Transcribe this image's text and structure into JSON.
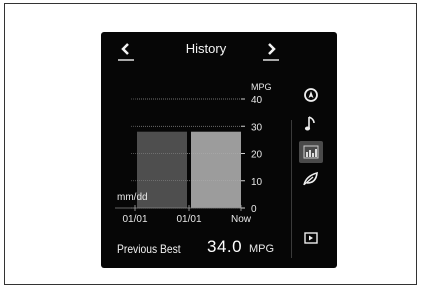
{
  "screen": {
    "title": "History",
    "prev_label": "<",
    "next_label": ">"
  },
  "side_icons": [
    {
      "name": "navigation-icon",
      "active": false
    },
    {
      "name": "music-note-icon",
      "active": false
    },
    {
      "name": "fuel-history-chart-icon",
      "active": true
    },
    {
      "name": "eco-leaf-icon",
      "active": false
    }
  ],
  "footer": {
    "label": "Previous Best",
    "value": "34.0",
    "unit": "MPG"
  },
  "colors": {
    "screen_bg": "#060606",
    "bar_previous": "#4e4e4e",
    "bar_current": "#9c9c9c",
    "text": "#f2f2f2"
  },
  "chart_data": {
    "type": "bar",
    "title": "",
    "xlabel": "mm/dd",
    "ylabel": "MPG",
    "ylim": [
      0,
      40
    ],
    "yticks": [
      "0",
      "10",
      "20",
      "30",
      "40"
    ],
    "grid": true,
    "categories": [
      "01/01",
      "01/01",
      "Now"
    ],
    "values": [
      28,
      28
    ]
  }
}
